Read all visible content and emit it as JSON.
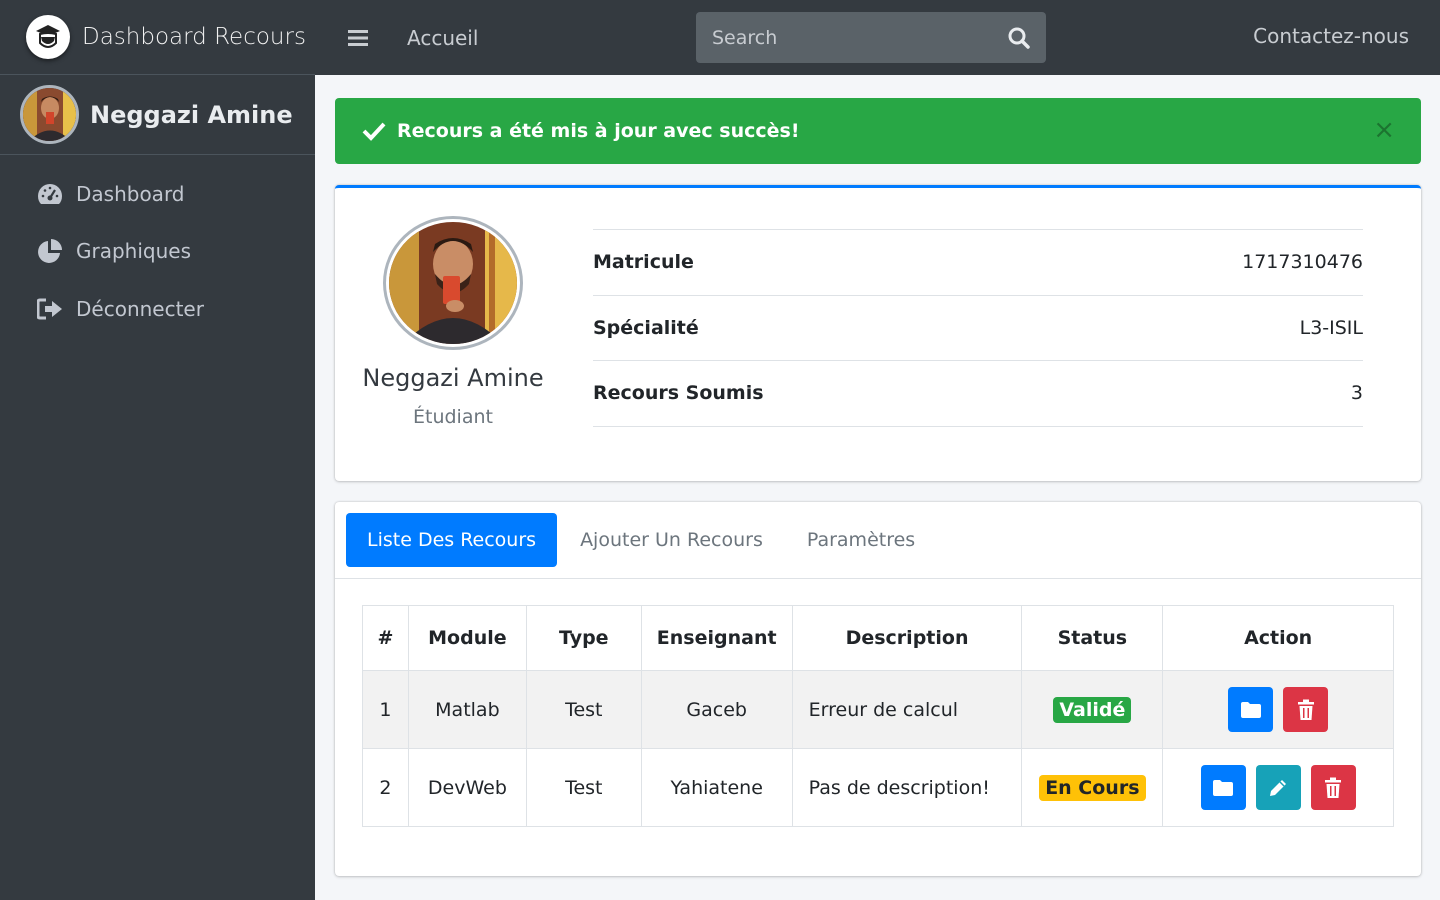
{
  "brand": {
    "title": "Dashboard Recours",
    "logo_icon": "student-mask-icon"
  },
  "user": {
    "name": "Neggazi Amine"
  },
  "sidebar": {
    "items": [
      {
        "label": "Dashboard",
        "icon": "tachometer-icon"
      },
      {
        "label": "Graphiques",
        "icon": "pie-chart-icon"
      },
      {
        "label": "Déconnecter",
        "icon": "sign-out-icon"
      }
    ]
  },
  "topbar": {
    "home_label": "Accueil",
    "search_placeholder": "Search",
    "contact_label": "Contactez-nous"
  },
  "alert": {
    "message": "Recours a été mis à jour avec succès!",
    "close": "×",
    "color": "#28a745"
  },
  "profile": {
    "name": "Neggazi Amine",
    "role": "Étudiant",
    "info": [
      {
        "key": "Matricule",
        "value": "1717310476"
      },
      {
        "key": "Spécialité",
        "value": "L3-ISIL"
      },
      {
        "key": "Recours Soumis",
        "value": "3"
      }
    ]
  },
  "tabs": {
    "items": [
      {
        "label": "Liste Des Recours",
        "active": true
      },
      {
        "label": "Ajouter Un Recours",
        "active": false
      },
      {
        "label": "Paramètres",
        "active": false
      }
    ]
  },
  "table": {
    "headers": [
      "#",
      "Module",
      "Type",
      "Enseignant",
      "Description",
      "Status",
      "Action"
    ],
    "rows": [
      {
        "num": "1",
        "module": "Matlab",
        "type": "Test",
        "enseignant": "Gaceb",
        "description": "Erreur de calcul",
        "status": "Validé",
        "status_color": "#28a745",
        "actions": [
          "view",
          "delete"
        ]
      },
      {
        "num": "2",
        "module": "DevWeb",
        "type": "Test",
        "enseignant": "Yahiatene",
        "description": "Pas de description!",
        "status": "En Cours",
        "status_color": "#ffc107",
        "actions": [
          "view",
          "edit",
          "delete"
        ]
      }
    ]
  },
  "colors": {
    "sidebar_bg": "#343a40",
    "primary": "#007bff",
    "success": "#28a745",
    "warning": "#ffc107",
    "danger": "#dc3545",
    "info": "#17a2b8"
  }
}
